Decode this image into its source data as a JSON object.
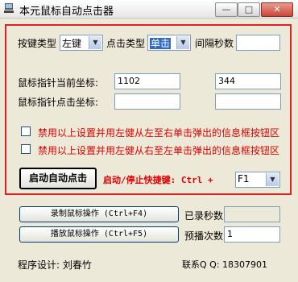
{
  "window": {
    "title": "本元鼠标自动点击器",
    "minimize": "—",
    "maximize": "□",
    "close": "✕"
  },
  "settings": {
    "button_type_label": "按键类型",
    "button_type_value": "左键",
    "click_type_label": "点击类型",
    "click_type_value": "单击",
    "interval_label": "间隔秒数",
    "interval_value": ""
  },
  "coords": {
    "current_label": "鼠标指针当前坐标:",
    "current_x": "1102",
    "current_y": "344",
    "click_label": "鼠标指针点击坐标:",
    "click_x": "",
    "click_y": ""
  },
  "options": [
    {
      "label": "禁用以上设置并用左健从左至右单击弹出的信息框按钮区",
      "checked": false
    },
    {
      "label": "禁用以上设置并用左健从右至左单击弹出的信息框按钮区",
      "checked": false
    }
  ],
  "actions": {
    "start_button": "启动自动点击",
    "hotkey_label": "启动/停止快捷键: Ctrl +",
    "hotkey_value": "F1"
  },
  "recording": {
    "record_button": "录制鼠标操作 (Ctrl+F4)",
    "play_button": "播放鼠标操作 (Ctrl+F5)",
    "record_seconds_label": "已录秒数",
    "record_seconds_value": "",
    "play_count_label": "预播次数",
    "play_count_value": "1"
  },
  "footer": {
    "designer": "程序设计: 刘春竹",
    "contact": "联系Q Q: 18307901"
  }
}
